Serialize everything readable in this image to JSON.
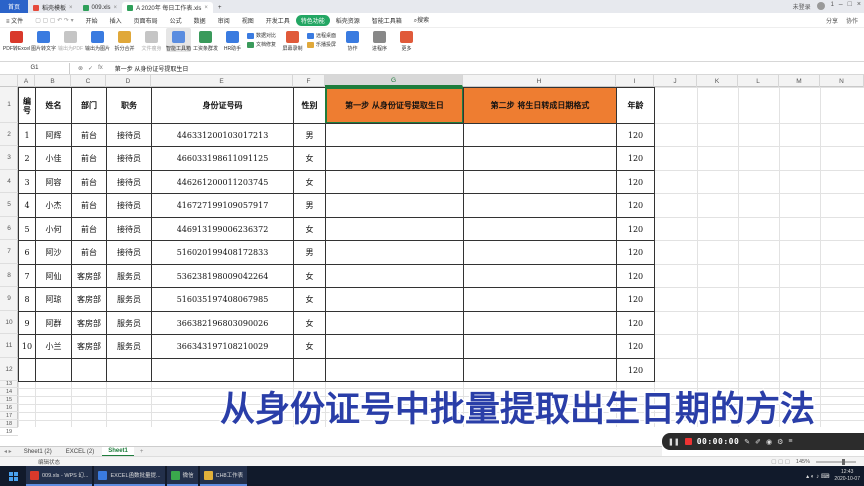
{
  "titlebar": {
    "tabs": [
      {
        "label": "首页",
        "icon": "home-icon"
      },
      {
        "label": "稻壳模板",
        "icon": "docer-icon"
      },
      {
        "label": "009.xls",
        "icon": "xls-icon"
      },
      {
        "label": "A 2020年 每日工作表.xls",
        "icon": "xls-icon"
      }
    ],
    "add_tab": "+",
    "right": [
      "未登录",
      "1"
    ]
  },
  "menubar": {
    "file": "文件",
    "items": [
      "开始",
      "插入",
      "页面布局",
      "公式",
      "数据",
      "审阅",
      "视图",
      "开发工具"
    ],
    "special": "特色功能",
    "more": [
      "稻壳资源",
      "智能工具箱"
    ],
    "search": "搜索",
    "right": [
      "分享",
      "协作"
    ]
  },
  "ribbon": {
    "big_buttons": [
      {
        "label": "PDF转Excel",
        "icon": "pdf-excel-icon",
        "color": "#d9392b"
      },
      {
        "label": "图片转文字",
        "icon": "image-text-icon",
        "color": "#3a7be0"
      },
      {
        "label": "输出为PDF",
        "icon": "export-pdf-icon",
        "color": "#c5c5c5"
      },
      {
        "label": "输出为图片",
        "icon": "export-image-icon",
        "color": "#3a7be0"
      },
      {
        "label": "拆分合并",
        "icon": "split-merge-icon",
        "color": "#e0a83a"
      },
      {
        "label": "文件瘦身",
        "icon": "slim-icon",
        "color": "#c5c5c5"
      },
      {
        "label": "智能工具箱",
        "icon": "toolbox-icon",
        "color": "#5a8de0"
      },
      {
        "label": "工资条群发",
        "icon": "salary-icon",
        "color": "#3a9a5b"
      },
      {
        "label": "HR助手",
        "icon": "hr-icon",
        "color": "#3a7be0"
      }
    ],
    "small_group1": [
      "数据对比",
      "文档修复"
    ],
    "small_group2": [
      "屏幕录制",
      "截图取字"
    ],
    "small_group3": [
      "远程桌面",
      "乐播投屏"
    ],
    "more_buttons": [
      {
        "label": "协作",
        "icon": "collab-icon",
        "color": "#3a7be0"
      },
      {
        "label": "进程序",
        "icon": "process-icon",
        "color": "#888"
      },
      {
        "label": "更多",
        "icon": "more-apps-icon",
        "color": "#e05a3a"
      }
    ]
  },
  "formula_bar": {
    "namebox": "G1",
    "icons": [
      "⊗",
      "✓",
      "fx"
    ],
    "content": "第一步  从身份证号提取生日"
  },
  "columns": [
    "A",
    "B",
    "C",
    "D",
    "E",
    "F",
    "G",
    "H",
    "I",
    "J",
    "K",
    "L",
    "M",
    "N"
  ],
  "rows": [
    "1",
    "2",
    "3",
    "4",
    "5",
    "6",
    "7",
    "8",
    "9",
    "10",
    "11",
    "12",
    "13",
    "14",
    "15",
    "16",
    "17",
    "18",
    "19"
  ],
  "table": {
    "headers": [
      "编号",
      "姓名",
      "部门",
      "职务",
      "身份证号码",
      "性别",
      "第一步  从身份证号提取生日",
      "第二步  将生日转成日期格式",
      "年龄"
    ],
    "records": [
      [
        "1",
        "阿辉",
        "前台",
        "接待员",
        "446331200103017213",
        "男",
        "",
        "",
        "120"
      ],
      [
        "2",
        "小佳",
        "前台",
        "接待员",
        "466033198611091125",
        "女",
        "",
        "",
        "120"
      ],
      [
        "3",
        "阿容",
        "前台",
        "接待员",
        "446261200011203745",
        "女",
        "",
        "",
        "120"
      ],
      [
        "4",
        "小杰",
        "前台",
        "接待员",
        "416727199109057917",
        "男",
        "",
        "",
        "120"
      ],
      [
        "5",
        "小何",
        "前台",
        "接待员",
        "446913199006236372",
        "女",
        "",
        "",
        "120"
      ],
      [
        "6",
        "阿沙",
        "前台",
        "接待员",
        "516020199408172833",
        "男",
        "",
        "",
        "120"
      ],
      [
        "7",
        "阿仙",
        "客房部",
        "服务员",
        "536238198009042264",
        "女",
        "",
        "",
        "120"
      ],
      [
        "8",
        "阿琼",
        "客房部",
        "服务员",
        "516035197408067985",
        "女",
        "",
        "",
        "120"
      ],
      [
        "9",
        "阿群",
        "客房部",
        "服务员",
        "366382196803090026",
        "女",
        "",
        "",
        "120"
      ],
      [
        "10",
        "小兰",
        "客房部",
        "服务员",
        "366343197108210029",
        "女",
        "",
        "",
        "120"
      ],
      [
        "",
        "",
        "",
        "",
        "",
        "",
        "",
        "",
        "120"
      ]
    ],
    "header_fill": "#ee7d31"
  },
  "caption": "从身份证号中批量提取出生日期的方法",
  "recorder": {
    "time": "00:00:00"
  },
  "sheet_tabs": [
    "Sheet1 (2)",
    "EXCEL (2)",
    "Sheet1"
  ],
  "active_sheet": "Sheet1",
  "status": {
    "left": "编辑状态",
    "zoom": "145%"
  },
  "taskbar": {
    "items": [
      {
        "label": "009.xls - WPS 幻...",
        "color": "#d9392b"
      },
      {
        "label": "EXCEL函数批量提...",
        "color": "#3a7be0"
      },
      {
        "label": "微信",
        "color": "#3aa84c"
      },
      {
        "label": "CH8工作表",
        "color": "#e0b03a"
      }
    ],
    "clock_time": "12:43",
    "clock_date": "2020-10-07"
  }
}
